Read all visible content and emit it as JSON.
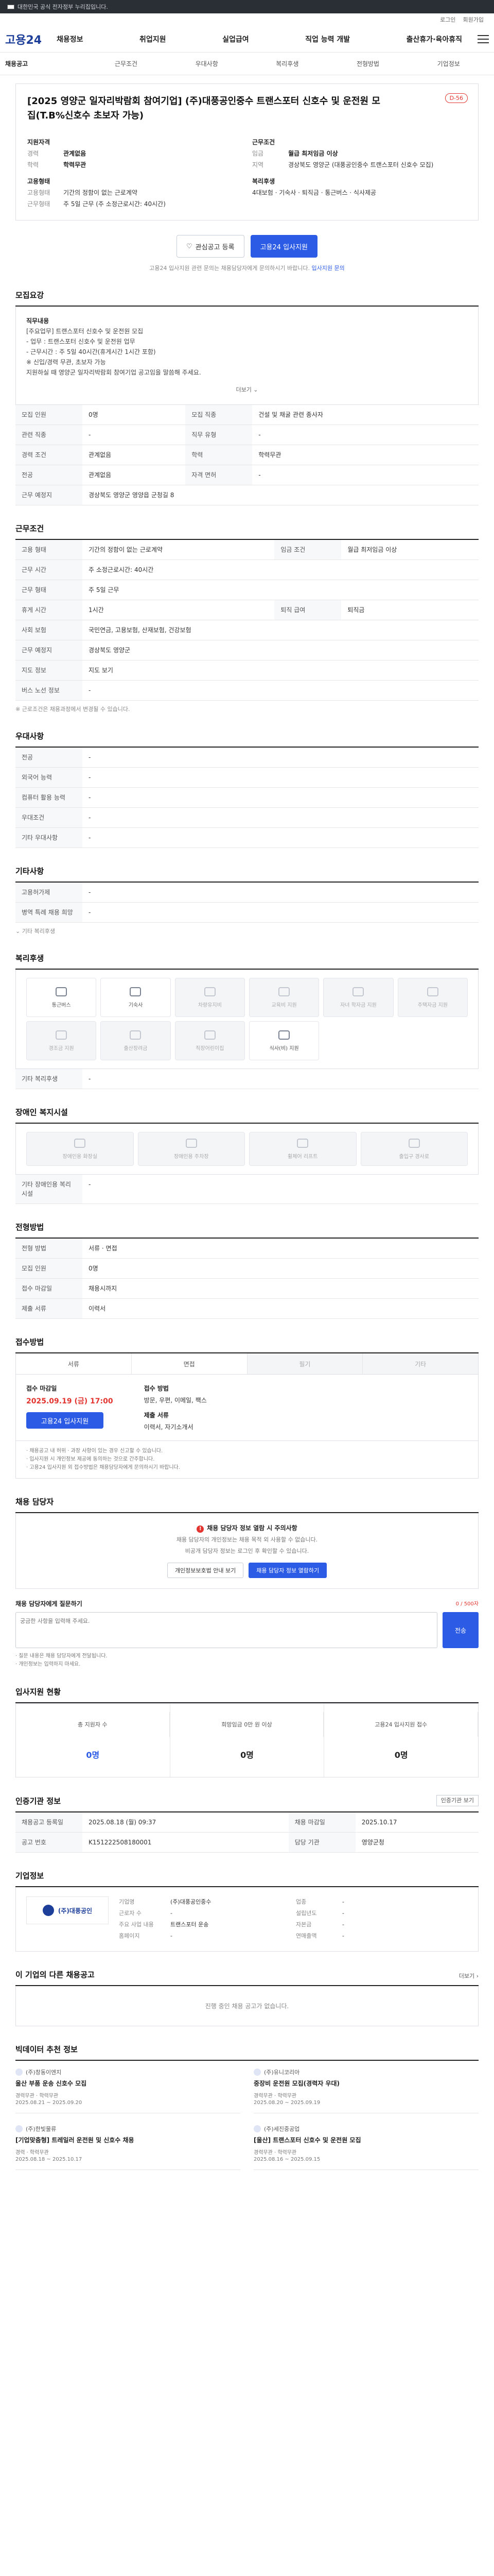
{
  "topbar": {
    "text": "대한민국 공식 전자정부 누리집입니다."
  },
  "util": {
    "links": [
      "로그인",
      "회원가입"
    ]
  },
  "site": {
    "logo": "고용24"
  },
  "gnb": {
    "menus": [
      "채용정보",
      "취업지원",
      "실업급여",
      "직업 능력 개발",
      "출산휴가·육아휴직"
    ]
  },
  "subnav": [
    "채용공고",
    "근무조건",
    "우대사항",
    "복리후생",
    "전형방법",
    "기업정보"
  ],
  "hero": {
    "badge": "D-56",
    "title": "[2025 영양군 일자리박람회 참여기업] (주)대풍공인중수 트랜스포터 신호수 및 운전원 모집(T.B%신호수 초보자 가능)",
    "left_title": "지원자격",
    "left": [
      {
        "k": "경력",
        "v": "관계없음"
      },
      {
        "k": "학력",
        "v": "학력무관"
      }
    ],
    "left_title2": "고용형태",
    "left2": [
      {
        "k": "고용형태",
        "v": "기간의 정함이 없는 근로계약"
      },
      {
        "k": "근무형태",
        "v": "주 5일 근무 (주 소정근로시간: 40시간)"
      }
    ],
    "right_title": "근무조건",
    "right": [
      {
        "k": "임금",
        "v": "월급 최저임금 이상"
      },
      {
        "k": "지역",
        "v": "경상북도 영양군 (대풍공인중수 트랜스포터 신호수 모집)"
      }
    ],
    "right_title2": "복리후생",
    "right2": [
      {
        "k": "",
        "v": "4대보험 · 기숙사 · 퇴직금 · 통근버스 · 식사제공"
      }
    ]
  },
  "actions": {
    "scrap": "관심공고 등록",
    "apply": "고용24 입사지원",
    "note": "고용24 입사지원 관련 문의는 채용담당자에게 문의하시기 바랍니다.",
    "note_link": "입사지원 문의"
  },
  "sections": {
    "recruit": "모집요강",
    "work": "근무조건",
    "prefer": "우대사항",
    "etc": "기타사항",
    "welfare": "복리후생",
    "disability": "장애인 복지시설",
    "process": "전형방법",
    "apply": "접수방법",
    "contact": "채용 담당자",
    "stats": "입사지원 현황",
    "certify": "인증기관 정보",
    "company": "기업정보",
    "others": "이 기업의 다른 채용공고",
    "recommend": "빅데이터 추천 정보"
  },
  "recruit_box": {
    "t1": "직무내용",
    "l1": "[주요업무] 트랜스포터 신호수 및 운전원 모집",
    "l2": "- 업무 : 트랜스포터 신호수 및 운전원 업무",
    "l3": "- 근무시간 : 주 5일 40시간(휴게시간 1시간 포함)",
    "l4": "※ 신입/경력 무관, 초보자 가능",
    "l5": "지원하실 때 영양군 일자리박람회 참여기업 공고임을 말씀해 주세요.",
    "fold": "더보기 ⌄"
  },
  "recruit_table": [
    {
      "k": "모집 인원",
      "v": "0명",
      "k2": "모집 직종",
      "v2": "건설 및 채굴 관련 종사자"
    },
    {
      "k": "관련 직종",
      "v": "-",
      "k2": "직무 유형",
      "v2": "-"
    },
    {
      "k": "경력 조건",
      "v": "관계없음",
      "k2": "학력",
      "v2": "학력무관"
    },
    {
      "k": "전공",
      "v": "관계없음",
      "k2": "자격 면허",
      "v2": "-"
    },
    {
      "k": "근무 예정지",
      "v": "경상북도 영양군 영양읍 군청길 8",
      "k2": "",
      "v2": ""
    }
  ],
  "work_table": [
    {
      "k": "고용 형태",
      "v": "기간의 정함이 없는 근로계약",
      "k2": "임금 조건",
      "v2": "월급 최저임금 이상"
    },
    {
      "k": "근무 시간",
      "v": "주 소정근로시간: 40시간"
    },
    {
      "k": "근무 형태",
      "v": "주 5일 근무",
      "k2": "",
      "v2": ""
    },
    {
      "k": "휴게 시간",
      "v": "1시간",
      "k2": "퇴직 급여",
      "v2": "퇴직금"
    },
    {
      "k": "사회 보험",
      "v": "국민연금, 고용보험, 산재보험, 건강보험",
      "k2": "",
      "v2": ""
    },
    {
      "k": "근무 예정지",
      "v": "경상북도 영양군",
      "k2": "",
      "v2": ""
    },
    {
      "k": "지도 정보",
      "v": "지도 보기",
      "k2": "",
      "v2": ""
    },
    {
      "k": "버스 노선 정보",
      "v": "-",
      "k2": "",
      "v2": ""
    }
  ],
  "work_note": "※ 근로조건은 채용과정에서 변경될 수 있습니다.",
  "prefer_table": [
    {
      "k": "전공",
      "v": "-"
    },
    {
      "k": "외국어 능력",
      "v": "-"
    },
    {
      "k": "컴퓨터 활용 능력",
      "v": "-"
    },
    {
      "k": "우대조건",
      "v": "-"
    },
    {
      "k": "기타 우대사항",
      "v": "-"
    }
  ],
  "etc_table": [
    {
      "k": "고용허가제",
      "v": "-"
    },
    {
      "k": "병역 특례 채용 희망",
      "v": "-"
    }
  ],
  "etc_fold": "기타 복리후생",
  "welfare": [
    {
      "label": "통근버스",
      "on": true
    },
    {
      "label": "기숙사",
      "on": true
    },
    {
      "label": "차량유지비",
      "on": false
    },
    {
      "label": "교육비 지원",
      "on": false
    },
    {
      "label": "자녀 학자금 지원",
      "on": false
    },
    {
      "label": "주택자금 지원",
      "on": false
    },
    {
      "label": "경조금 지원",
      "on": false
    },
    {
      "label": "출산장려금",
      "on": false
    },
    {
      "label": "직장어린이집",
      "on": false
    },
    {
      "label": "식사(비) 지원",
      "on": true
    }
  ],
  "welfare_etc": {
    "k": "기타 복리후생",
    "v": "-"
  },
  "disability": [
    {
      "label": "장애인용 화장실"
    },
    {
      "label": "장애인용 주차장"
    },
    {
      "label": "휠체어 리프트"
    },
    {
      "label": "출입구 경사로"
    }
  ],
  "disability_etc": {
    "k": "기타 장애인용 복리시설",
    "v": "-"
  },
  "process_table": [
    {
      "k": "전형 방법",
      "v": "서류 · 면접"
    },
    {
      "k": "모집 인원",
      "v": "0명"
    },
    {
      "k": "접수 마감일",
      "v": "채용시까지"
    },
    {
      "k": "제출 서류",
      "v": "이력서"
    }
  ],
  "apply_steps": [
    {
      "label": "서류",
      "on": true
    },
    {
      "label": "면접",
      "on": true
    },
    {
      "label": "필기",
      "on": false
    },
    {
      "label": "기타",
      "on": false
    }
  ],
  "apply_box": {
    "l1": "접수 마감일",
    "v1": "2025.09.19 (금) 17:00",
    "l2": "접수 방법",
    "v2": "방문, 우편, 이메일, 팩스",
    "l3": "제출 서류",
    "v3": "이력서, 자기소개서",
    "btn": "고용24 입사지원"
  },
  "apply_bullets": [
    "· 채용공고 내 허위 · 과장 사항이 있는 경우 신고할 수 있습니다.",
    "· 입사지원 시 개인정보 제공에 동의하는 것으로 간주합니다.",
    "· 고용24 입사지원 외 접수방법은 채용담당자에게 문의하시기 바랍니다."
  ],
  "contact": {
    "warn": "채용 담당자 정보 열람 시 주의사항",
    "p1": "채용 담당자의 개인정보는 채용 목적 외 사용할 수 없습니다.",
    "p2": "비공개 담당자 정보는 로그인 후 확인할 수 있습니다.",
    "b1": "개인정보보호법 안내 보기",
    "b2": "채용 담당자 정보 열람하기"
  },
  "question": {
    "title": "채용 담당자에게 질문하기",
    "warn": "0 / 500자",
    "placeholder": "궁금한 사항을 입력해 주세요.",
    "send": "전송",
    "n1": "· 질문 내용은 채용 담당자에게 전달됩니다.",
    "n2": "· 개인정보는 입력하지 마세요."
  },
  "stats": [
    {
      "label": "총 지원자 수",
      "value": "0명"
    },
    {
      "label": "희망임금 0만 원 이상",
      "value": "0명"
    },
    {
      "label": "고용24 입사지원 접수",
      "value": "0명"
    }
  ],
  "certify_more": "인증기관 보기",
  "certify_table": [
    {
      "k": "채용공고 등록일",
      "v": "2025.08.18 (월) 09:37",
      "k2": "채용 마감일",
      "v2": "2025.10.17"
    },
    {
      "k": "공고 번호",
      "v": "K151222508180001",
      "k2": "담당 기관",
      "v2": "영양군청"
    }
  ],
  "company": {
    "logo": "(주)대풍공인",
    "rows": [
      {
        "k": "기업명",
        "v": "(주)대풍공인중수",
        "k2": "업종",
        "v2": "-"
      },
      {
        "k": "근로자 수",
        "v": "-",
        "k2": "설립년도",
        "v2": "-"
      },
      {
        "k": "주요 사업 내용",
        "v": "트랜스포터 운송",
        "k2": "자본금",
        "v2": "-"
      },
      {
        "k": "홈페이지",
        "v": "-",
        "k2": "연매출액",
        "v2": "-"
      }
    ]
  },
  "others_empty": "진행 중인 채용 공고가 없습니다.",
  "others_more": "더보기 ›",
  "recommend": [
    {
      "co": "(주)창동이엔지",
      "title": "울산 부품 운송 신호수 모집",
      "meta": "경력무관 · 학력무관",
      "date": "2025.08.21 ~ 2025.09.20"
    },
    {
      "co": "(주)유니코리아",
      "title": "중장비 운전원 모집(경력자 우대)",
      "meta": "경력무관 · 학력무관",
      "date": "2025.08.20 ~ 2025.09.19"
    },
    {
      "co": "(주)한빛물류",
      "title": "[기업맞춤형] 트레일러 운전원 및 신호수 채용",
      "meta": "경력 · 학력무관",
      "date": "2025.08.18 ~ 2025.10.17"
    },
    {
      "co": "(주)세진중공업",
      "title": "[울산] 트랜스포터 신호수 및 운전원 모집",
      "meta": "경력무관 · 학력무관",
      "date": "2025.08.16 ~ 2025.09.15"
    }
  ]
}
